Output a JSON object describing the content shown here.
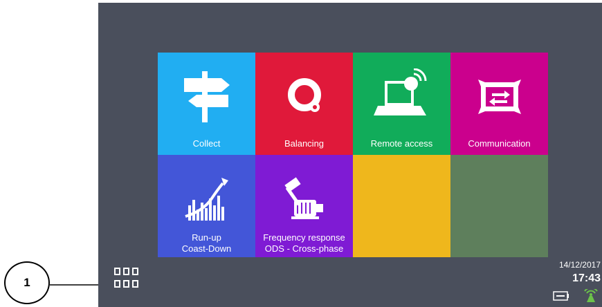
{
  "callout": {
    "number": "1"
  },
  "tiles": [
    {
      "label": "Collect",
      "color": "#21aef2",
      "icon": "signpost-icon"
    },
    {
      "label": "Balancing",
      "color": "#e0193a",
      "icon": "balancing-icon"
    },
    {
      "label": "Remote access",
      "color": "#11ac5a",
      "icon": "remote-access-laptop-icon"
    },
    {
      "label": "Communication",
      "color": "#cb008d",
      "icon": "communication-transfer-icon"
    },
    {
      "label_line1": "Run-up",
      "label_line2": "Coast-Down",
      "color": "#4356d8",
      "icon": "run-up-chart-icon"
    },
    {
      "label_line1": "Frequency response",
      "label_line2": "ODS - Cross-phase",
      "color": "#7f1bd4",
      "icon": "hammer-motor-icon"
    },
    {
      "label": "",
      "color": "#efb71c",
      "icon": ""
    },
    {
      "label": "",
      "color": "#5e7f5c",
      "icon": ""
    }
  ],
  "status": {
    "date": "14/12/2017",
    "time": "17:43",
    "battery_icon": "battery-icon",
    "signal_icon": "wireless-signal-icon"
  },
  "apps_button_icon": "apps-grid-icon",
  "screen_color": "#4a4f5c"
}
